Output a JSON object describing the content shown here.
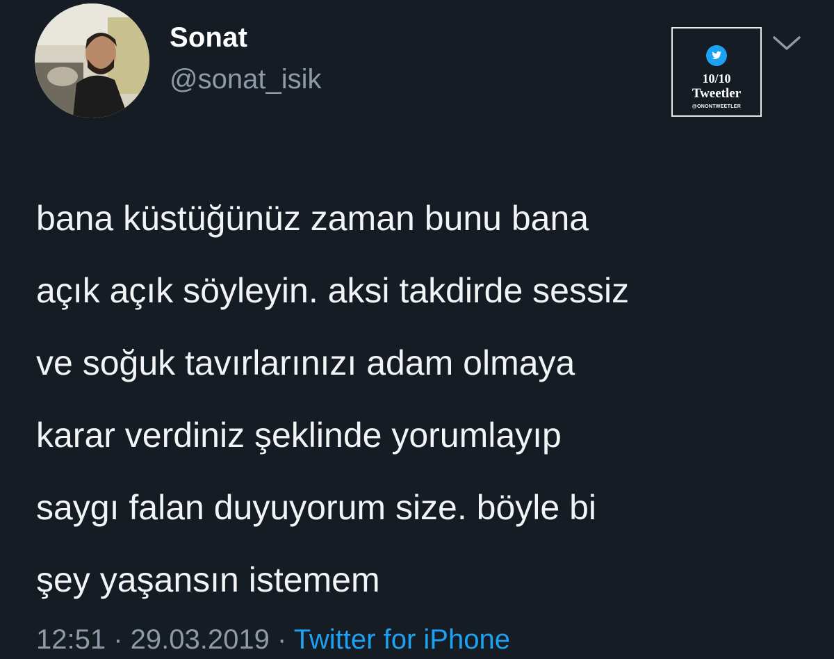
{
  "author": {
    "display_name": "Sonat",
    "handle": "@sonat_isik"
  },
  "tweet": {
    "lines": [
      "bana küstüğünüz zaman bunu bana",
      "açık açık söyleyin. aksi takdirde sessiz",
      "ve soğuk tavırlarınızı adam olmaya",
      "karar verdiniz şeklinde yorumlayıp",
      "saygı falan duyuyorum size. böyle bi",
      "şey yaşansın istemem"
    ]
  },
  "meta": {
    "time": "12:51",
    "separator": " · ",
    "date": "29.03.2019",
    "source": "Twitter for iPhone"
  },
  "watermark": {
    "score": "10/10",
    "word": "Tweetler",
    "handle": "@ONONTWEETLER",
    "icon": "twitter-bird-icon"
  },
  "icons": {
    "menu": "chevron-down-icon",
    "avatar": "profile-photo"
  },
  "colors": {
    "background": "#151c24",
    "text": "#f2f4f6",
    "muted": "#8e9aa6",
    "link": "#1da1f2"
  }
}
